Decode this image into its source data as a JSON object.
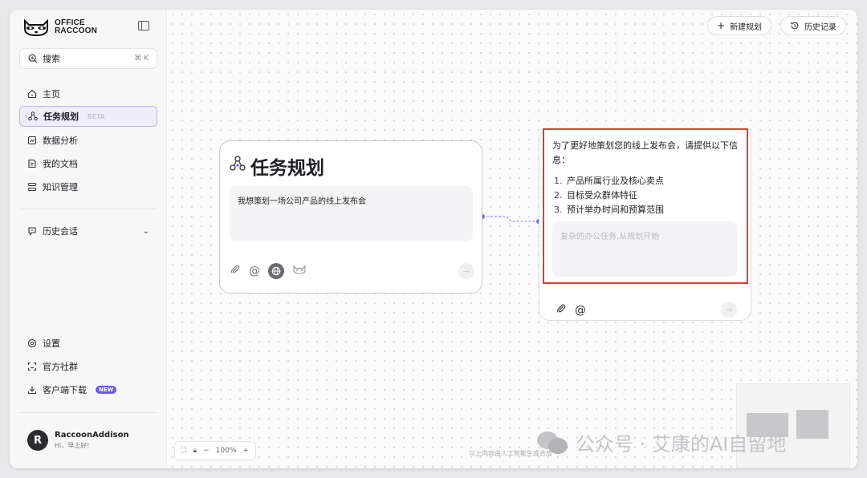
{
  "app": {
    "logo_line1": "OFFICE",
    "logo_line2": "RACCOON"
  },
  "search": {
    "label": "搜索",
    "shortcut": "⌘ K"
  },
  "nav": {
    "home": "主页",
    "task_planning": "任务规划",
    "beta": "BETA",
    "data_analysis": "数据分析",
    "my_docs": "我的文档",
    "knowledge": "知识管理",
    "history_chats": "历史会话"
  },
  "bottom_nav": {
    "settings": "设置",
    "community": "官方社群",
    "download": "客户端下载",
    "new_badge": "NEW"
  },
  "user": {
    "initial": "R",
    "name": "RaccoonAddison",
    "greeting": "Hi，早上好!"
  },
  "toolbar": {
    "new_plan": "新建规划",
    "history": "历史记录"
  },
  "task_card": {
    "title": "任务规划",
    "prompt": "我想策划一场公司产品的线上发布会"
  },
  "response_card": {
    "intro": "为了更好地策划您的线上发布会，请提供以下信息：",
    "items": [
      {
        "num": "1.",
        "text": "产品所属行业及核心卖点"
      },
      {
        "num": "2.",
        "text": "目标受众群体特征"
      },
      {
        "num": "3.",
        "text": "预计举办时间和预算范围"
      }
    ],
    "input_placeholder": "复杂的办公任务,从规划开始"
  },
  "zoom": {
    "level": "100%"
  },
  "disclaimer": "以上内容由人工智能生成合成",
  "watermark": "公众号 · 艾康的AI自留地",
  "colors": {
    "accent": "#6b5ce7",
    "highlight": "#e03b32"
  }
}
